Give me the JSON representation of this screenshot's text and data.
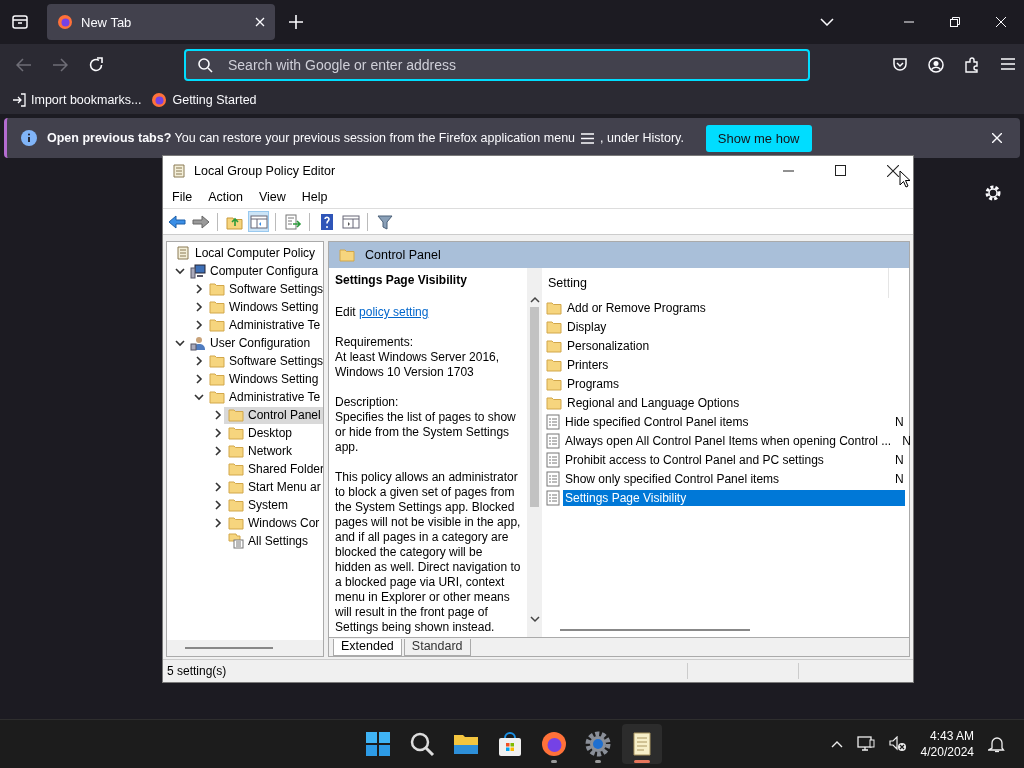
{
  "browser": {
    "tabs": [
      {
        "title": "New Tab",
        "selected": true
      }
    ],
    "address_bar": {
      "placeholder": "Search with Google or enter address"
    },
    "nav": {
      "back_disabled": true,
      "forward_disabled": true
    },
    "bookmarks": [
      {
        "kind": "import",
        "label": "Import bookmarks..."
      },
      {
        "kind": "firefox",
        "label": "Getting Started"
      }
    ],
    "notification": {
      "message": "**Open previous tabs?** You can restore your previous session from the Firefox application menu",
      "message_end": ", under History.",
      "button": "Show me how"
    }
  },
  "window": {
    "title": "Local Group Policy Editor",
    "menu": [
      "File",
      "Action",
      "View",
      "Help"
    ],
    "toolbar": [
      [
        {
          "kind": "back",
          "pressed": false
        },
        {
          "kind": "forward",
          "pressed": false
        }
      ],
      [
        {
          "kind": "folder-up",
          "pressed": false
        },
        {
          "kind": "tree-toggle",
          "pressed": true
        }
      ],
      [
        {
          "kind": "export",
          "pressed": false
        }
      ],
      [
        {
          "kind": "help",
          "pressed": false
        },
        {
          "kind": "properties",
          "pressed": false
        }
      ],
      [
        {
          "kind": "filter",
          "pressed": false
        }
      ]
    ],
    "tree": [
      {
        "label": "Local Computer Policy",
        "kind": "policy",
        "selected": false,
        "children": [
          {
            "label": "Computer Configura",
            "kind": "computer",
            "expandable": true,
            "expanded": true,
            "selected": false,
            "children": [
              {
                "label": "Software Settings",
                "kind": "folder",
                "expandable": true,
                "expanded": false,
                "selected": false
              },
              {
                "label": "Windows Setting",
                "kind": "folder",
                "expandable": true,
                "expanded": false,
                "selected": false
              },
              {
                "label": "Administrative Te",
                "kind": "folder",
                "expandable": true,
                "expanded": false,
                "selected": false
              }
            ]
          },
          {
            "label": "User Configuration",
            "kind": "user",
            "expandable": true,
            "expanded": true,
            "selected": false,
            "children": [
              {
                "label": "Software Settings",
                "kind": "folder",
                "expandable": true,
                "expanded": false,
                "selected": false
              },
              {
                "label": "Windows Setting",
                "kind": "folder",
                "expandable": true,
                "expanded": false,
                "selected": false
              },
              {
                "label": "Administrative Te",
                "kind": "folder",
                "expandable": true,
                "expanded": true,
                "selected": false,
                "children": [
                  {
                    "label": "Control Panel",
                    "kind": "folder",
                    "expandable": true,
                    "expanded": false,
                    "selected": true
                  },
                  {
                    "label": "Desktop",
                    "kind": "folder",
                    "expandable": true,
                    "expanded": false,
                    "selected": false
                  },
                  {
                    "label": "Network",
                    "kind": "folder",
                    "expandable": true,
                    "expanded": false,
                    "selected": false
                  },
                  {
                    "label": "Shared Folder",
                    "kind": "folder",
                    "expandable": false,
                    "expanded": false,
                    "selected": false
                  },
                  {
                    "label": "Start Menu ar",
                    "kind": "folder",
                    "expandable": true,
                    "expanded": false,
                    "selected": false
                  },
                  {
                    "label": "System",
                    "kind": "folder",
                    "expandable": true,
                    "expanded": false,
                    "selected": false
                  },
                  {
                    "label": "Windows Cor",
                    "kind": "folder",
                    "expandable": true,
                    "expanded": false,
                    "selected": false
                  },
                  {
                    "label": "All Settings",
                    "kind": "settings",
                    "expandable": false,
                    "expanded": false,
                    "selected": false
                  }
                ]
              }
            ]
          }
        ]
      }
    ],
    "header": "Control Panel",
    "description": {
      "title": "Settings Page Visibility",
      "edit_prefix": "Edit",
      "edit_link": "policy setting",
      "requirements_label": "Requirements:",
      "requirements": "At least Windows Server 2016, Windows 10 Version 1703",
      "description_label": "Description:",
      "paragraphs": [
        "Specifies the list of pages to show or hide from the System Settings app.",
        "This policy allows an administrator to block a given set of pages from the System Settings app. Blocked pages will not be visible in the app, and if all pages in a category are blocked the category will be hidden as well. Direct navigation to a blocked page via URI, context menu in Explorer or other means will result in the front page of Settings being shown instead."
      ]
    },
    "list": {
      "column": "Setting",
      "items": [
        {
          "kind": "folder",
          "label": "Add or Remove Programs",
          "selected": false
        },
        {
          "kind": "folder",
          "label": "Display",
          "selected": false
        },
        {
          "kind": "folder",
          "label": "Personalization",
          "selected": false
        },
        {
          "kind": "folder",
          "label": "Printers",
          "selected": false
        },
        {
          "kind": "folder",
          "label": "Programs",
          "selected": false
        },
        {
          "kind": "folder",
          "label": "Regional and Language Options",
          "selected": false
        },
        {
          "kind": "setting",
          "label": "Hide specified Control Panel items",
          "column_2": "N",
          "selected": false
        },
        {
          "kind": "setting",
          "label": "Always open All Control Panel Items when opening Control ...",
          "column_2": "N",
          "selected": false
        },
        {
          "kind": "setting",
          "label": "Prohibit access to Control Panel and PC settings",
          "column_2": "N",
          "selected": false
        },
        {
          "kind": "setting",
          "label": "Show only specified Control Panel items",
          "column_2": "N",
          "selected": false
        },
        {
          "kind": "setting",
          "label": "Settings Page Visibility",
          "selected": true
        }
      ]
    },
    "view_tabs": [
      {
        "label": "Extended",
        "selected": true
      },
      {
        "label": "Standard",
        "selected": false
      }
    ],
    "status_bar": "5 setting(s)"
  },
  "taskbar": {
    "apps": [
      {
        "kind": "start",
        "running": false,
        "active": false
      },
      {
        "kind": "search",
        "running": false,
        "active": false
      },
      {
        "kind": "explorer",
        "running": false,
        "active": false
      },
      {
        "kind": "store",
        "running": false,
        "active": false
      },
      {
        "kind": "firefox",
        "running": true,
        "active": false
      },
      {
        "kind": "settings",
        "running": true,
        "active": false
      },
      {
        "kind": "policy",
        "running": true,
        "active": true
      }
    ],
    "time": "4:43 AM",
    "date": "4/20/2024"
  }
}
